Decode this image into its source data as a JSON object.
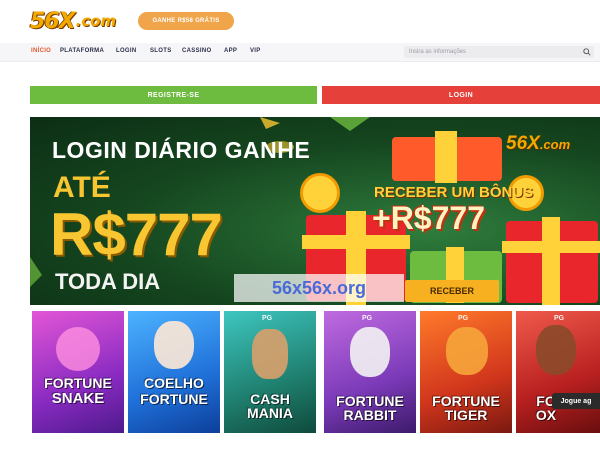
{
  "header": {
    "logo_text": "56X",
    "logo_suffix": ".com",
    "promo_label": "GANHE R$58 GRÁTIS"
  },
  "nav": {
    "items": [
      {
        "label": "INÍCIO",
        "active": true
      },
      {
        "label": "PLATAFORMA"
      },
      {
        "label": "LOGIN"
      },
      {
        "label": "SLOTS"
      },
      {
        "label": "CASSINO"
      },
      {
        "label": "APP"
      },
      {
        "label": "VIP"
      }
    ],
    "search_placeholder": "Insira as informações"
  },
  "auth": {
    "register_label": "REGISTRE-SE",
    "login_label": "LOGIN"
  },
  "banner": {
    "line1": "LOGIN DIÁRIO GANHE",
    "line2": "ATÉ",
    "amount": "R$777",
    "line4": "TODA DIA",
    "logo_text": "56X",
    "logo_suffix": ".com",
    "receive_title": "RECEBER UM BÔNUS",
    "bonus": "+R$777",
    "receive_button": "RECEBER",
    "watermark": "56x56x.org"
  },
  "games": [
    {
      "line1": "FORTUNE",
      "line2": "SNAKE",
      "provider": ""
    },
    {
      "line1": "COELHO",
      "line2": "FORTUNE",
      "provider": ""
    },
    {
      "line1": "CASH",
      "line2": "MANIA",
      "provider": "PG"
    },
    {
      "line1": "FORTUNE",
      "line2": "RABBIT",
      "provider": "PG"
    },
    {
      "line1": "FORTUNE",
      "line2": "TIGER",
      "provider": "PG"
    },
    {
      "line1": "FO",
      "line2": "OX",
      "provider": "PG"
    }
  ],
  "play_label": "Jogue ag",
  "colors": {
    "accent_orange": "#f0a54b",
    "register_green": "#6dbb3f",
    "login_red": "#e5403a",
    "banner_green": "#15461f",
    "gold": "#f7c631"
  }
}
